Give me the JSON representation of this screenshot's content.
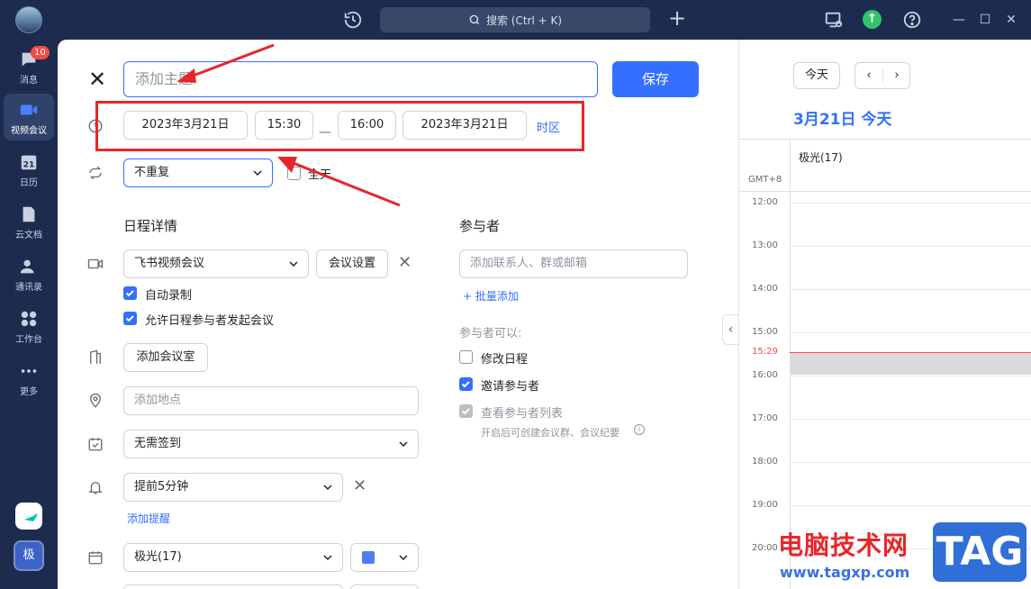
{
  "topbar": {
    "search_label": "搜索 (Ctrl + K)"
  },
  "nav": {
    "items": [
      {
        "label": "消息",
        "icon": "chat-bubble-icon",
        "badge": "10"
      },
      {
        "label": "视频会议",
        "icon": "video-camera-icon",
        "active": true
      },
      {
        "label": "日历",
        "icon": "calendar-icon",
        "day": "21"
      },
      {
        "label": "云文档",
        "icon": "cloud-doc-icon"
      },
      {
        "label": "通讯录",
        "icon": "contacts-icon"
      },
      {
        "label": "工作台",
        "icon": "grid-icon"
      },
      {
        "label": "更多",
        "icon": "more-dots-icon"
      }
    ],
    "user_initial": "极"
  },
  "form": {
    "title_placeholder": "添加主题",
    "save_label": "保存",
    "start_date": "2023年3月21日",
    "start_time": "15:30",
    "dash": "—",
    "end_time": "16:00",
    "end_date": "2023年3月21日",
    "timezone_label": "时区",
    "repeat_value": "不重复",
    "allday_label": "全天",
    "details_heading": "日程详情",
    "meeting_type": "飞书视频会议",
    "meeting_settings": "会议设置",
    "auto_record": "自动录制",
    "allow_start": "允许日程参与者发起会议",
    "add_room": "添加会议室",
    "location_placeholder": "添加地点",
    "checkin_value": "无需签到",
    "reminder_value": "提前5分钟",
    "add_reminder": "添加提醒",
    "calendar_value": "极光(17)",
    "event_color": "#4f7df7",
    "participants_heading": "参与者",
    "participants_placeholder": "添加联系人、群或邮箱",
    "bulk_add": "+ 批量添加",
    "participants_can": "参与者可以:",
    "perm_modify": "修改日程",
    "perm_invite": "邀请参与者",
    "perm_view": "查看参与者列表",
    "perm_note": "开启后可创建会议群、会议纪要"
  },
  "calendar": {
    "today_label": "今天",
    "date_heading": "3月21日 今天",
    "calendar_name": "极光(17)",
    "timezone": "GMT+8",
    "hours": [
      "12:00",
      "13:00",
      "14:00",
      "15:00",
      "16:00",
      "17:00",
      "18:00",
      "19:00",
      "20:00"
    ],
    "now_label": "15:29"
  },
  "watermark": {
    "text": "电脑技术网",
    "url": "www.tagxp.com",
    "tag": "TAG"
  },
  "colors": {
    "accent": "#3370ff",
    "annotation_red": "#e8262a",
    "sidebar": "#1d2b4f"
  }
}
